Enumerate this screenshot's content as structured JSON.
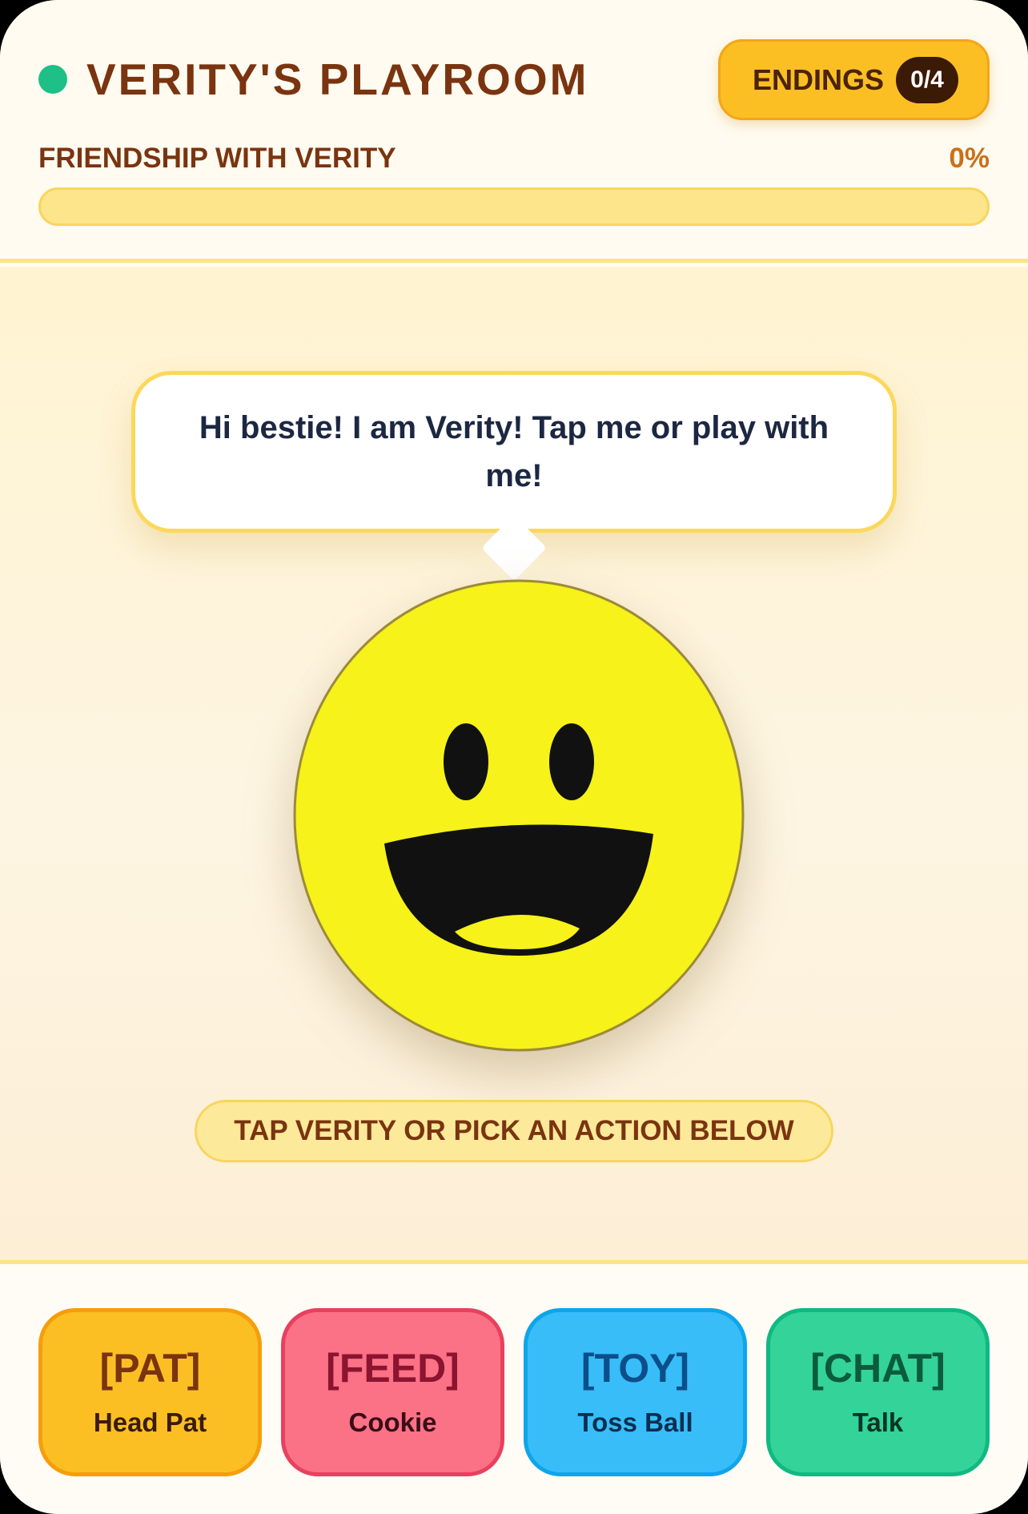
{
  "header": {
    "title": "VERITY'S PLAYROOM",
    "status_icon": "online-dot-icon",
    "status_color": "#1fbf88",
    "endings": {
      "label": "ENDINGS",
      "count": "0/4"
    },
    "friendship": {
      "label": "FRIENDSHIP WITH VERITY",
      "value_text": "0%",
      "value": 0
    }
  },
  "stage": {
    "speech": "Hi bestie! I am Verity! Tap me or play with me!",
    "character": {
      "name": "Verity",
      "icon": "smiley-face-icon",
      "color": "#f6f21a"
    },
    "hint": "TAP VERITY OR PICK AN ACTION BELOW"
  },
  "actions": [
    {
      "code": "[PAT]",
      "label": "Head Pat",
      "color": "#fbbf24"
    },
    {
      "code": "[FEED]",
      "label": "Cookie",
      "color": "#fb7185"
    },
    {
      "code": "[TOY]",
      "label": "Toss Ball",
      "color": "#38bdf8"
    },
    {
      "code": "[CHAT]",
      "label": "Talk",
      "color": "#34d399"
    }
  ]
}
